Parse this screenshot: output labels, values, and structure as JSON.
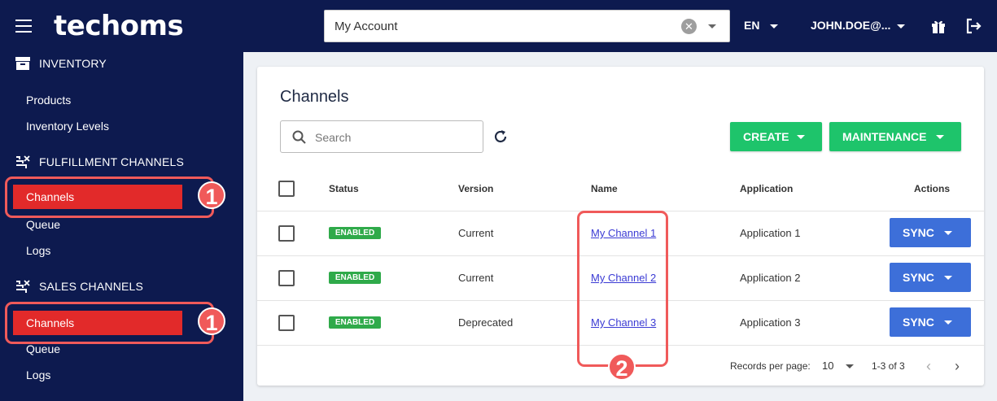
{
  "header": {
    "app_name": "techoms",
    "account_value": "My Account",
    "language": "EN",
    "user": "JOHN.DOE@..."
  },
  "sidebar": {
    "inventory": {
      "title": "INVENTORY",
      "items": [
        "Products",
        "Inventory Levels"
      ]
    },
    "fulfillment": {
      "title": "FULFILLMENT CHANNELS",
      "items": [
        "Channels",
        "Queue",
        "Logs"
      ]
    },
    "sales": {
      "title": "SALES CHANNELS",
      "items": [
        "Channels",
        "Queue",
        "Logs"
      ]
    }
  },
  "callouts": {
    "one": "1",
    "two": "2"
  },
  "main": {
    "title": "Channels",
    "search_placeholder": "Search",
    "create_label": "CREATE",
    "maintenance_label": "MAINTENANCE",
    "columns": {
      "status": "Status",
      "version": "Version",
      "name": "Name",
      "application": "Application",
      "actions": "Actions"
    },
    "rows": [
      {
        "status": "ENABLED",
        "version": "Current",
        "name": "My Channel 1",
        "application": "Application 1",
        "action": "SYNC"
      },
      {
        "status": "ENABLED",
        "version": "Current",
        "name": "My Channel 2",
        "application": "Application 2",
        "action": "SYNC"
      },
      {
        "status": "ENABLED",
        "version": "Deprecated",
        "name": "My Channel 3",
        "application": "Application 3",
        "action": "SYNC"
      }
    ],
    "pagination": {
      "records_label": "Records per page:",
      "per_page": "10",
      "range": "1-3 of 3"
    }
  },
  "colors": {
    "navy": "#0d1a4f",
    "active_red": "#e22a2a",
    "callout": "#f05a5a",
    "green": "#1ec46b",
    "blue": "#3d6fd9"
  }
}
